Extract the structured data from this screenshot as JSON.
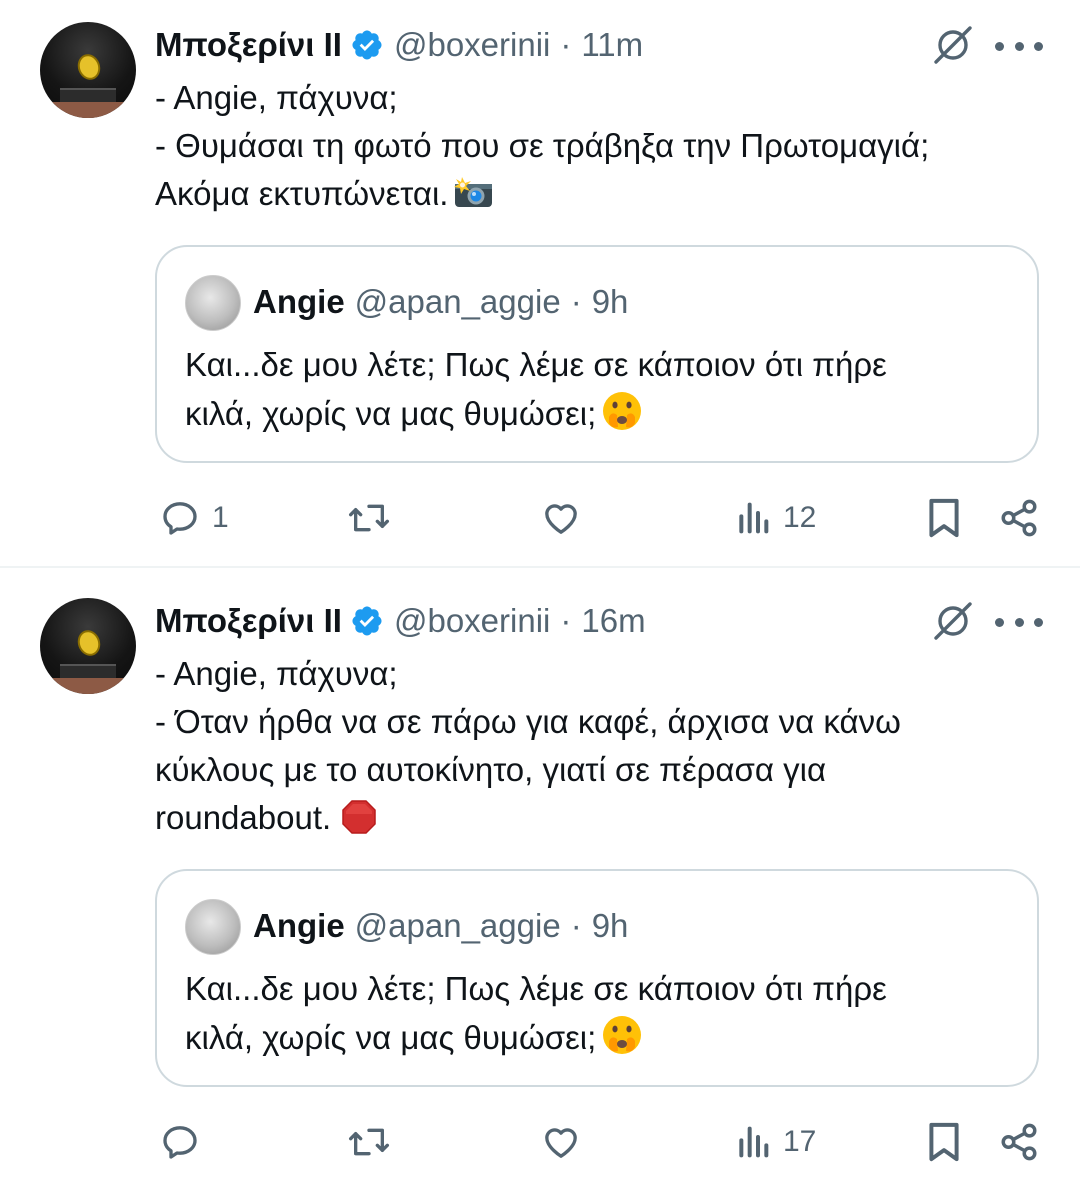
{
  "tweets": [
    {
      "author_name": "Μποξερίνι ΙΙ",
      "handle": "@boxerinii",
      "separator": "·",
      "time": "11m",
      "lines": [
        "- Angie, πάχυνα;",
        "- Θυμάσαι τη φωτό που σε τράβηξα την Πρωτομαγιά;",
        "Ακόμα εκτυπώνεται."
      ],
      "emoji": "camera-flash",
      "quote": {
        "author_name": "Angie",
        "handle": "@apan_aggie",
        "separator": "·",
        "time": "9h",
        "lines": [
          "Και...δε μου λέτε; Πως λέμε σε κάποιον ότι πήρε",
          "κιλά, χωρίς να μας θυμώσει;"
        ]
      },
      "actions": {
        "replies": "1",
        "retweets": "",
        "likes": "",
        "views": "12"
      }
    },
    {
      "author_name": "Μποξερίνι ΙΙ",
      "handle": "@boxerinii",
      "separator": "·",
      "time": "16m",
      "lines": [
        "- Angie, πάχυνα;",
        "- Όταν ήρθα να σε πάρω για καφέ, άρχισα να κάνω",
        "κύκλους με το αυτοκίνητο, γιατί σε πέρασα για",
        "roundabout."
      ],
      "emoji": "stop-sign",
      "quote": {
        "author_name": "Angie",
        "handle": "@apan_aggie",
        "separator": "·",
        "time": "9h",
        "lines": [
          "Και...δε μου λέτε; Πως λέμε σε κάποιον ότι πήρε",
          "κιλά, χωρίς να μας θυμώσει;"
        ]
      },
      "actions": {
        "replies": "",
        "retweets": "",
        "likes": "",
        "views": "17"
      }
    }
  ],
  "colors": {
    "verified": "#1d9bf0",
    "secondary_text": "#536471",
    "text": "#0f1419",
    "border": "#cfd9de"
  },
  "icons": [
    "verified-badge-icon",
    "grok-icon",
    "more-icon",
    "reply-icon",
    "retweet-icon",
    "like-icon",
    "views-icon",
    "bookmark-icon",
    "share-icon"
  ]
}
